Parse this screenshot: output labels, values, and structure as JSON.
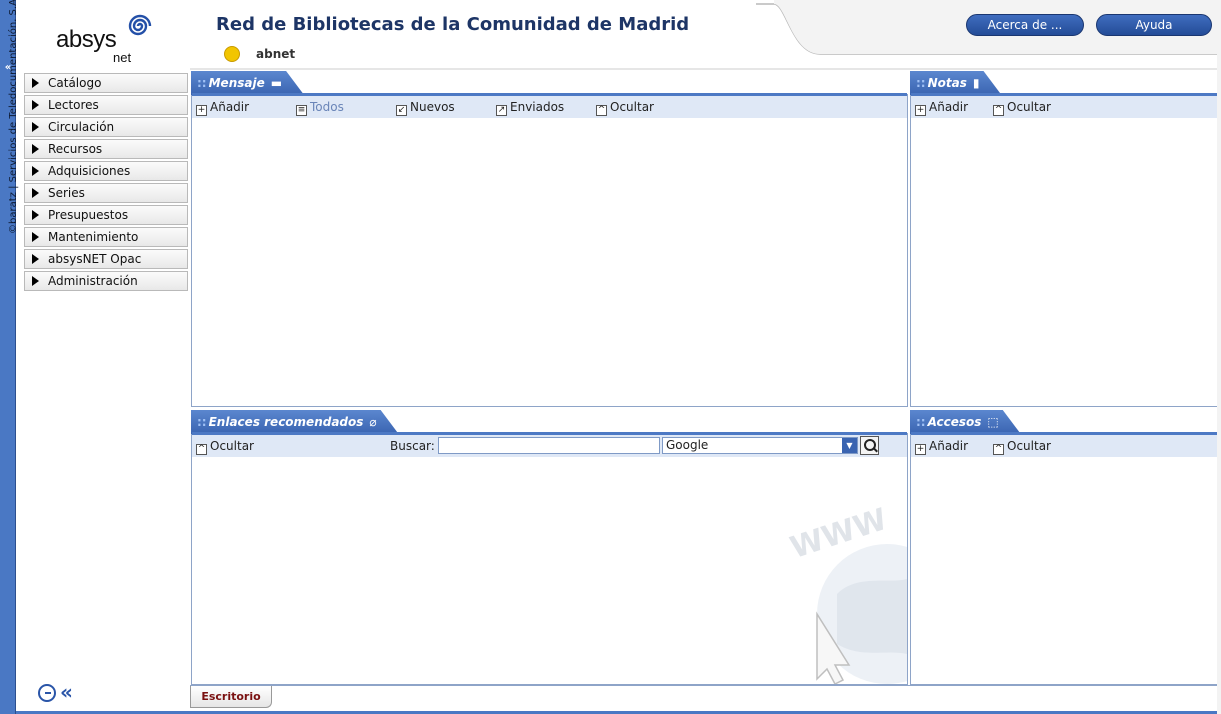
{
  "sidebar_strip": {
    "collapse_label": "«",
    "credit": "©baratz | Servicios de Teledocumentación, S.A."
  },
  "header": {
    "logo_main": "absys",
    "logo_sub": "net",
    "title": "Red de Bibliotecas de la Comunidad de Madrid",
    "user": "abnet",
    "about_label": "Acerca de ...",
    "help_label": "Ayuda",
    "accent_color": "#2b55a3"
  },
  "menu": {
    "items": [
      {
        "label": "Catálogo"
      },
      {
        "label": "Lectores"
      },
      {
        "label": "Circulación"
      },
      {
        "label": "Recursos"
      },
      {
        "label": "Adquisiciones"
      },
      {
        "label": "Series"
      },
      {
        "label": "Presupuestos"
      },
      {
        "label": "Mantenimiento"
      },
      {
        "label": "absysNET Opac"
      },
      {
        "label": "Administración"
      }
    ]
  },
  "panels": {
    "mensaje": {
      "title": "Mensaje",
      "tools": {
        "add": "Añadir",
        "all": "Todos",
        "new": "Nuevos",
        "sent": "Enviados",
        "hide": "Ocultar"
      }
    },
    "notas": {
      "title": "Notas",
      "tools": {
        "add": "Añadir",
        "hide": "Ocultar"
      }
    },
    "enlaces": {
      "title": "Enlaces recomendados",
      "tools": {
        "hide": "Ocultar"
      },
      "search_label": "Buscar:",
      "search_value": "",
      "engine_selected": "Google"
    },
    "accesos": {
      "title": "Accesos",
      "tools": {
        "add": "Añadir",
        "hide": "Ocultar"
      }
    }
  },
  "bottom": {
    "tab_label": "Escritorio"
  }
}
